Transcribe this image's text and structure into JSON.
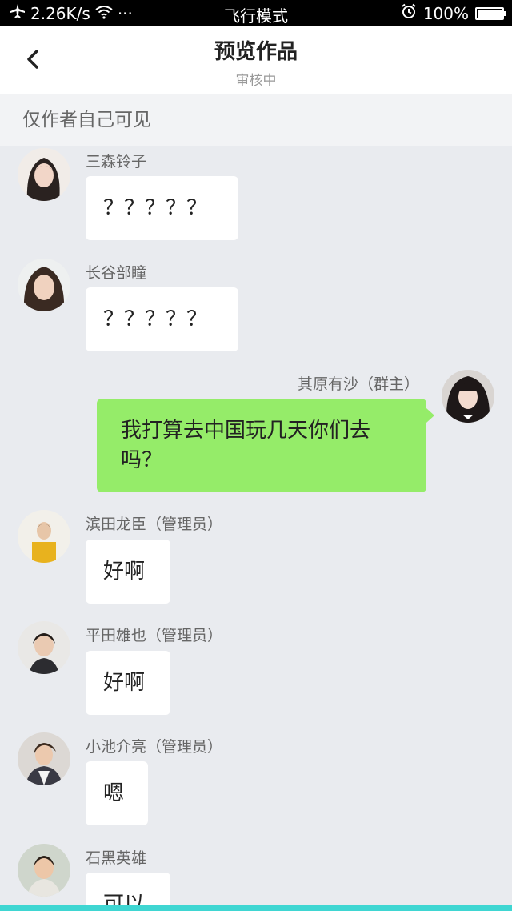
{
  "status_bar": {
    "speed": "2.26K/s",
    "dots": "···",
    "mode": "飞行模式",
    "battery": "100%",
    "battery_level": 1.0
  },
  "header": {
    "title": "预览作品",
    "subtitle": "审核中"
  },
  "notice": "仅作者自己可见",
  "messages": [
    {
      "name": "三森铃子",
      "text": "？？？？？",
      "self": false
    },
    {
      "name": "长谷部瞳",
      "text": "？？？？？",
      "self": false
    },
    {
      "name": "其原有沙（群主）",
      "text": "我打算去中国玩几天你们去吗？",
      "self": true
    },
    {
      "name": "滨田龙臣（管理员）",
      "text": "好啊",
      "self": false
    },
    {
      "name": "平田雄也（管理员）",
      "text": "好啊",
      "self": false
    },
    {
      "name": "小池介亮（管理员）",
      "text": "嗯",
      "self": false
    },
    {
      "name": "石黑英雄",
      "text": "可以",
      "self": false
    }
  ],
  "colors": {
    "self_bubble": "#95ec69",
    "chat_bg": "#e9ebef",
    "bottom_bar": "#3fd6d2"
  }
}
